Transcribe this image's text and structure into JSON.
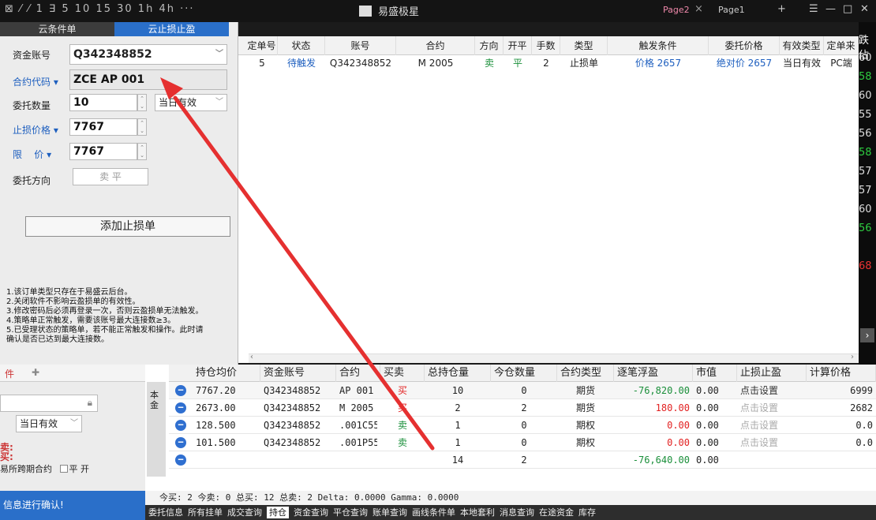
{
  "titlebar": {
    "tools": "⊠ ⁄ ⁄  1  ∃  5  10  15  30  1h  4h  ···",
    "app_title": "易盛极星",
    "page2": "Page2",
    "page1": "Page1",
    "plus": "+",
    "menu": "☰",
    "min": "—",
    "max": "□",
    "close": "✕"
  },
  "left_tabs": [
    "云条件单",
    "云止损止盈"
  ],
  "form": {
    "account_label": "资金账号",
    "account_value": "Q342348852",
    "contract_label": "合约代码",
    "contract_value": "ZCE AP 001",
    "qty_label": "委托数量",
    "qty_value": "10",
    "validity": "当日有效",
    "stop_price_label": "止损价格",
    "stop_price_value": "7767",
    "limit_label_a": "限",
    "limit_label_b": "价",
    "limit_value": "7767",
    "direction_label": "委托方向",
    "direction_value": "卖 平",
    "add_button": "添加止损单"
  },
  "notes": [
    "1.该订单类型只存在于易盛云后台。",
    "2.关闭软件不影响云盈损单的有效性。",
    "3.修改密码后必须再登录一次，否则云盈损单无法触发。",
    "4.策略单正常触发，需要该账号最大连接数≥3。",
    "5.已受理状态的策略单，若不能正常触发和操作。此时请",
    "确认是否已达到最大连接数。"
  ],
  "orders": {
    "headers": [
      "定单号",
      "状态",
      "账号",
      "合约",
      "方向",
      "开平",
      "手数",
      "类型",
      "触发条件",
      "委托价格",
      "有效类型",
      "定单来"
    ],
    "rows": [
      [
        "5",
        "待触发",
        "Q342348852",
        "M 2005",
        "卖",
        "平",
        "2",
        "止损单",
        "价格 2657",
        "绝对价 2657",
        "当日有效",
        "PC端"
      ]
    ]
  },
  "right_strip": [
    "跌佔",
    "60",
    "58",
    "60",
    "55",
    "56",
    "58",
    "57",
    "57",
    "60",
    "56",
    "68"
  ],
  "bottom_left": {
    "head_a": "件",
    "head_b": "✚",
    "validity": "当日有效",
    "sell": "卖:",
    "buy": "买:",
    "cross": "易所跨期合约",
    "chk_ping": "平",
    "chk_kai": "开",
    "confirm": "信息进行确认!"
  },
  "positions": {
    "headers": [
      "持仓均价",
      "资金账号",
      "合约",
      "买卖",
      "总持仓量",
      "今仓数量",
      "合约类型",
      "逐笔浮盈",
      "市值",
      "止损止盈",
      "计算价格"
    ],
    "rows": [
      [
        "7767.20",
        "Q342348852",
        "AP 001",
        "买",
        "10",
        "0",
        "期货",
        "-76,820.00",
        "0.00",
        "点击设置",
        "6999"
      ],
      [
        "2673.00",
        "Q342348852",
        "M 2005",
        "买",
        "2",
        "2",
        "期货",
        "180.00",
        "0.00",
        "点击设置",
        "2682"
      ],
      [
        "128.500",
        "Q342348852",
        ".001C55",
        "卖",
        "1",
        "0",
        "期权",
        "0.00",
        "0.00",
        "点击设置",
        "0.0"
      ],
      [
        "101.500",
        "Q342348852",
        ".001P55",
        "卖",
        "1",
        "0",
        "期权",
        "0.00",
        "0.00",
        "点击设置",
        "0.0"
      ],
      [
        "",
        "",
        "",
        "",
        "14",
        "2",
        "",
        "-76,640.00",
        "0.00",
        "",
        ""
      ]
    ],
    "side_tab": "本金"
  },
  "status_line": "今买: 2  今卖: 0  总买: 12  总卖: 2  Delta: 0.0000  Gamma: 0.0000",
  "footer_tabs": [
    "委托信息",
    "所有挂单",
    "成交查询",
    "持仓",
    "资金查询",
    "平仓查询",
    "账单查询",
    "画线条件单",
    "本地套利",
    "消息查询",
    "在途资金",
    "库存"
  ],
  "colors": {
    "accent": "#2a6fc9",
    "sell": "#1a8f3a",
    "buy": "#e22222",
    "arrow": "#e53030"
  }
}
